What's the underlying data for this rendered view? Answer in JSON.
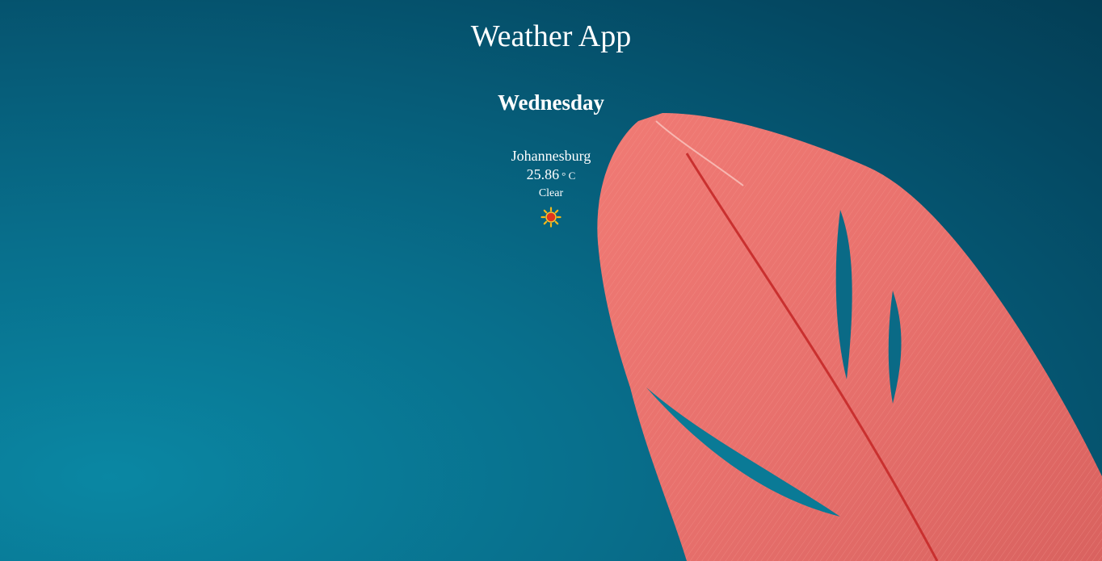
{
  "app": {
    "title": "Weather App"
  },
  "forecast": {
    "day": "Wednesday",
    "city": "Johannesburg",
    "temperature": "25.86",
    "unit": "° C",
    "condition": "Clear",
    "icon": "sun-icon"
  },
  "colors": {
    "background": "#065c78",
    "feather": "#e8716d",
    "text": "#ffffff"
  }
}
